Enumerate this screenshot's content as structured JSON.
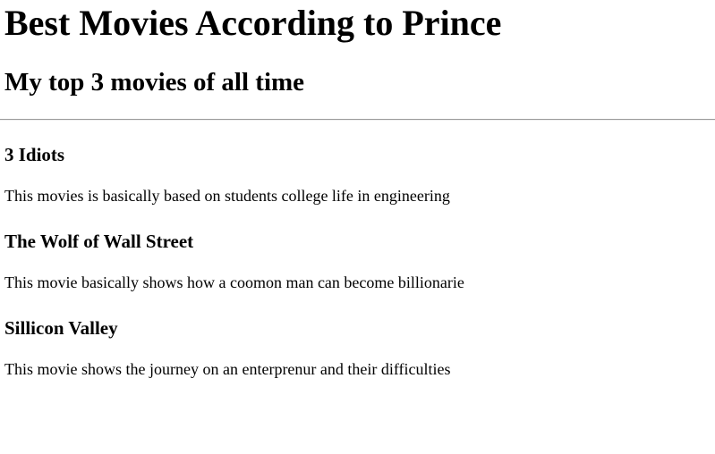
{
  "page": {
    "title": "Best Movies According to Prince",
    "subtitle": "My top 3 movies of all time"
  },
  "movies": [
    {
      "title": "3 Idiots",
      "description": "This movies is basically based on students college life in engineering"
    },
    {
      "title": "The Wolf of Wall Street",
      "description": "This movie basically shows how a coomon man can become billionarie"
    },
    {
      "title": "Sillicon Valley",
      "description": "This movie shows the journey on an enterprenur and their difficulties"
    }
  ]
}
